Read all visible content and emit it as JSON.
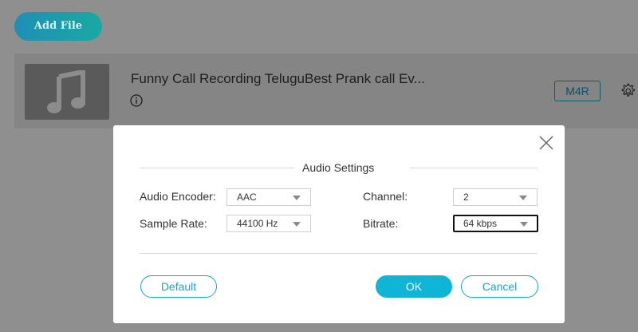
{
  "toolbar": {
    "add_file_label": "Add File"
  },
  "file": {
    "title": "Funny Call Recording TeluguBest Prank call Ev...",
    "format_label": "M4R",
    "thumbnail_icon": "music-note-icon",
    "info_icon": "info-icon",
    "settings_icon": "gear-icon"
  },
  "dialog": {
    "section_title": "Audio Settings",
    "fields": {
      "audio_encoder": {
        "label": "Audio Encoder:",
        "value": "AAC"
      },
      "sample_rate": {
        "label": "Sample Rate:",
        "value": "44100 Hz"
      },
      "channel": {
        "label": "Channel:",
        "value": "2"
      },
      "bitrate": {
        "label": "Bitrate:",
        "value": "64 kbps"
      }
    },
    "buttons": {
      "default": "Default",
      "ok": "OK",
      "cancel": "Cancel"
    },
    "close_icon": "close-icon"
  },
  "colors": {
    "accent": "#10b5d6",
    "overlay": "#8f8f8f"
  }
}
